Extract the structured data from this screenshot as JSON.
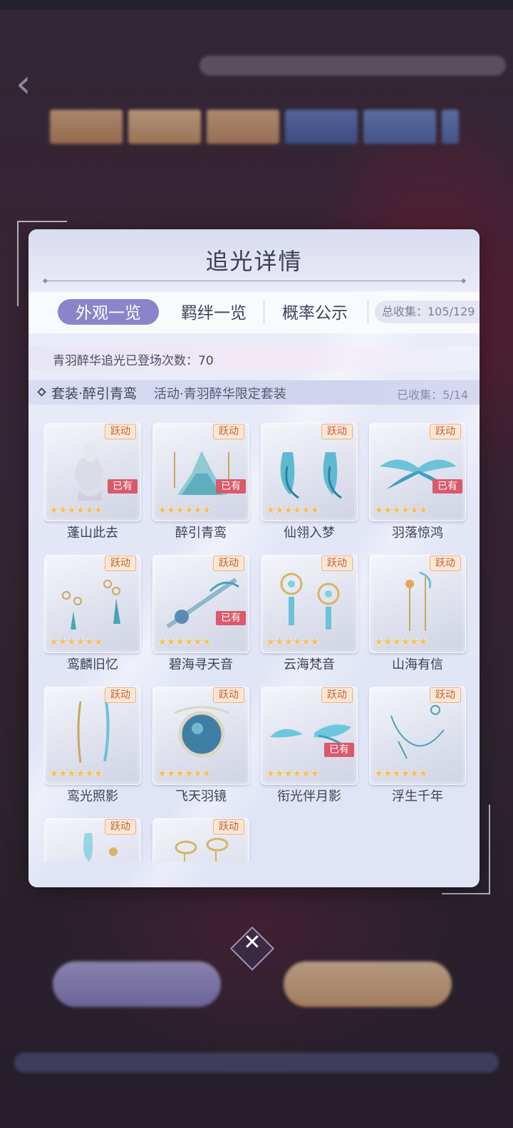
{
  "panel": {
    "title": "追光详情"
  },
  "tabs": [
    {
      "label": "外观一览",
      "active": true
    },
    {
      "label": "羁绊一览",
      "active": false
    },
    {
      "label": "概率公示",
      "active": false
    }
  ],
  "collect_total": "总收集：105/129",
  "appear_count": "青羽醉华追光已登场次数：70",
  "set": {
    "name": "套装·醉引青鸾",
    "subtitle": "活动·青羽醉华限定套装",
    "collected": "已收集：5/14"
  },
  "badges": {
    "event": "跃动",
    "owned": "已有"
  },
  "stars": "★★★★★★",
  "colors": {
    "accent": "#8a84c9",
    "owned_badge": "#d95a6b",
    "event_badge_text": "#c0643a",
    "star": "#f2c064"
  },
  "items": [
    {
      "name": "蓬山此去",
      "owned": true,
      "icon": "hair-icon"
    },
    {
      "name": "醉引青鸾",
      "owned": true,
      "icon": "dress-icon"
    },
    {
      "name": "仙翎入梦",
      "owned": false,
      "icon": "sleeves-icon"
    },
    {
      "name": "羽落惊鸿",
      "owned": true,
      "icon": "wings-icon"
    },
    {
      "name": "鸾麟旧忆",
      "owned": false,
      "icon": "earrings-icon"
    },
    {
      "name": "碧海寻天音",
      "owned": true,
      "icon": "flute-icon"
    },
    {
      "name": "云海梵音",
      "owned": false,
      "icon": "ring-earrings-icon"
    },
    {
      "name": "山海有信",
      "owned": false,
      "icon": "hairpin-icon"
    },
    {
      "name": "鸾光照影",
      "owned": false,
      "icon": "ribbon-icon"
    },
    {
      "name": "飞天羽镜",
      "owned": false,
      "icon": "mirror-icon"
    },
    {
      "name": "衔光伴月影",
      "owned": true,
      "icon": "feather-wings-icon"
    },
    {
      "name": "浮生千年",
      "owned": false,
      "icon": "necklace-icon"
    },
    {
      "name": "",
      "owned": false,
      "icon": "veil-icon"
    },
    {
      "name": "",
      "owned": false,
      "icon": "bracelet-icon"
    }
  ],
  "close_label": "✕"
}
